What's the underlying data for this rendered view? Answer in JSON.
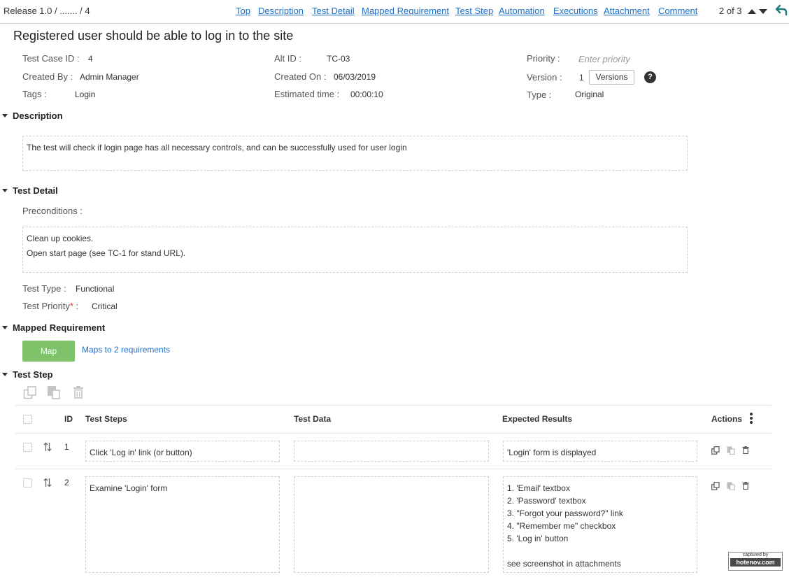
{
  "breadcrumb": {
    "release": "Release 1.0 /",
    "middle": "....... /",
    "id": "4"
  },
  "nav": [
    "Top",
    "Description",
    "Test Detail",
    "Mapped Requirement",
    "Test Step",
    "Automation",
    "Executions",
    "Attachment",
    "Comment"
  ],
  "counter": "2 of 3",
  "title": "Registered user should be able to log in to the site",
  "fields": {
    "test_case_id": {
      "label": "Test Case ID :",
      "value": "4"
    },
    "created_by": {
      "label": "Created By :",
      "value": "Admin Manager"
    },
    "tags": {
      "label": "Tags :",
      "value": "Login"
    },
    "alt_id": {
      "label": "Alt ID :",
      "value": "TC-03"
    },
    "created_on": {
      "label": "Created On :",
      "value": "06/03/2019"
    },
    "estimated_time": {
      "label": "Estimated time :",
      "value": "00:00:10"
    },
    "priority": {
      "label": "Priority :",
      "placeholder": "Enter priority"
    },
    "version": {
      "label": "Version :",
      "value": "1",
      "button": "Versions"
    },
    "type": {
      "label": "Type :",
      "value": "Original"
    },
    "help": "?"
  },
  "sections": {
    "description": "Description",
    "test_detail": "Test Detail",
    "mapped_requirement": "Mapped Requirement",
    "test_step": "Test Step"
  },
  "description_text": "The test will check if login page has all necessary controls, and can be successfully used for user login",
  "test_detail": {
    "preconditions_label": "Preconditions :",
    "preconditions": [
      "Clean up cookies.",
      "Open start page (see TC-1 for stand URL)."
    ],
    "test_type": {
      "label": "Test Type :",
      "value": "Functional"
    },
    "test_priority": {
      "label": "Test Priority",
      "required_mark": "*",
      "colon": " :",
      "value": "Critical"
    }
  },
  "mapped": {
    "button": "Map",
    "link": "Maps to 2 requirements"
  },
  "steps_table": {
    "headers": {
      "id": "ID",
      "steps": "Test Steps",
      "data": "Test Data",
      "expected": "Expected Results",
      "actions": "Actions"
    },
    "rows": [
      {
        "id": "1",
        "step": "Click 'Log in' link (or button)",
        "data": "",
        "expected": [
          "'Login' form is displayed"
        ]
      },
      {
        "id": "2",
        "step": "Examine 'Login' form",
        "data": "",
        "expected": [
          "1. 'Email' textbox",
          "2. 'Password' textbox",
          "3. \"Forgot your password?\" link",
          "4. \"Remember me\" checkbox",
          "5. 'Log in' button",
          "",
          "see screenshot in attachments"
        ]
      }
    ]
  },
  "watermark": {
    "top": "captured by",
    "name": "hotenov.com"
  },
  "colors": {
    "link": "#1d6fc6",
    "map_button": "#7ec36a",
    "border": "#cfcfcf"
  },
  "icons": [
    "arrow-up-icon",
    "arrow-down-icon",
    "back-arrow-icon",
    "help-icon",
    "clone-icon",
    "paste-icon",
    "trash-icon",
    "more-vertical-icon",
    "reorder-icon"
  ]
}
